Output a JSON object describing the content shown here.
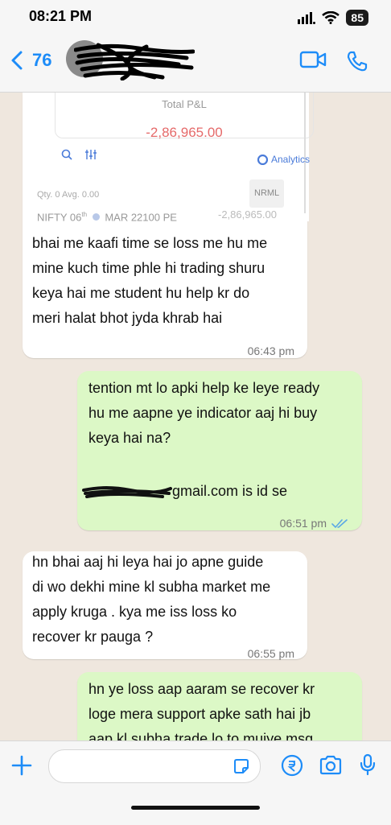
{
  "status_bar": {
    "time": "08:21 PM",
    "battery": "85"
  },
  "header": {
    "back_label": "76",
    "colors": {
      "accent": "#1d8cf8"
    }
  },
  "screenshot": {
    "pl_label": "Total P&L",
    "pl_value": "-2,86,965.00",
    "analytics_label": "Analytics",
    "qty_text": "Qty. 0  Avg. 0.00",
    "product_tag": "NRML",
    "instrument_prefix": "NIFTY 06",
    "instrument_sup": "th",
    "instrument_suffix": "MAR 22100 PE",
    "position_pl": "-2,86,965.00"
  },
  "messages": [
    {
      "direction": "in",
      "text": "bhai me kaafi time se loss me hu me\nmine kuch time phle hi trading shuru\nkeya hai me student hu help kr do\nmeri halat bhot jyda khrab hai",
      "time": "06:43 pm"
    },
    {
      "direction": "out",
      "text": "tention mt lo apki help ke leye ready\nhu me aapne ye indicator aaj hi buy\nkeya hai na?",
      "email_suffix": "gmail.com is id se",
      "time": "06:51 pm"
    },
    {
      "direction": "in",
      "text": "hn bhai aaj hi leya hai jo apne guide\ndi wo dekhi mine kl subha market me\napply kruga . kya me iss loss ko\nrecover kr pauga ?",
      "time": "06:55 pm"
    },
    {
      "direction": "out",
      "text": "hn ye loss aap aaram se recover kr\nloge mera support apke sath hai jb\naap kl subha trade lo to mujye msg"
    }
  ],
  "composer": {
    "placeholder": ""
  }
}
